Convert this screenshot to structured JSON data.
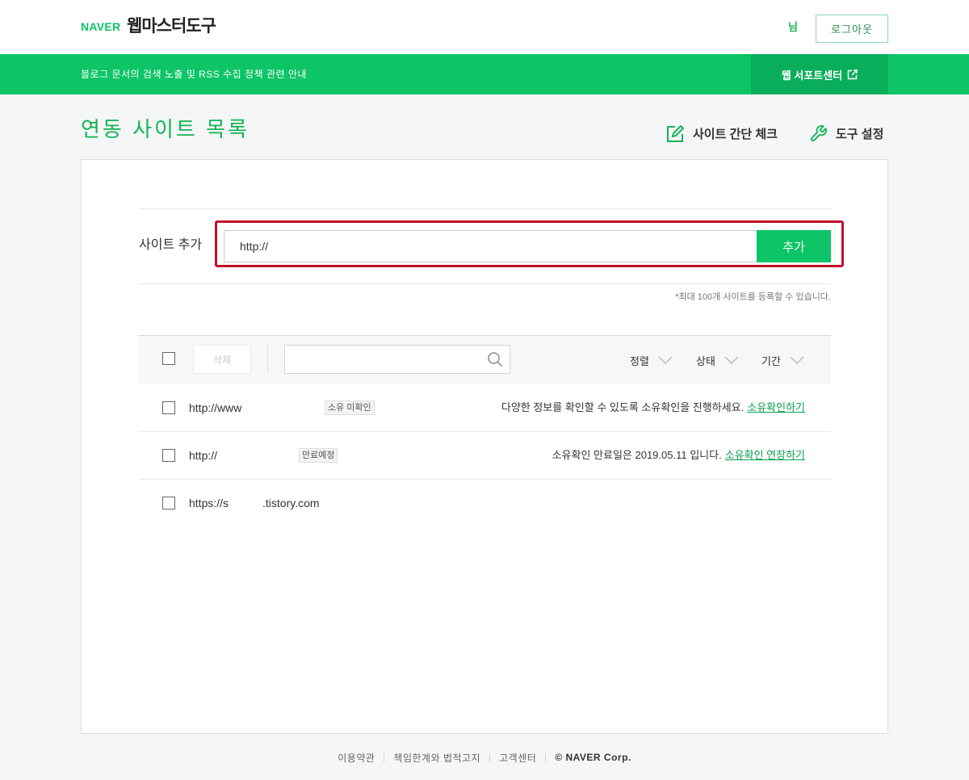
{
  "header": {
    "logo_naver": "NAVER",
    "logo_title": "웹마스터도구",
    "user_suffix": "님",
    "logout_label": "로그아웃"
  },
  "notice_bar": {
    "text": "블로그 문서의 검색 노출 및 RSS 수집 정책 관련 안내",
    "support_label": "웹 서포트센터",
    "support_icon": "external-link-icon"
  },
  "page": {
    "title": "연동 사이트 목록",
    "actions": [
      {
        "label": "사이트 간단 체크",
        "icon": "edit-box-icon"
      },
      {
        "label": "도구 설정",
        "icon": "wrench-icon"
      }
    ]
  },
  "add_site": {
    "label": "사이트 추가",
    "input_value": "http://",
    "button_label": "추가",
    "limit_note": "*최대 100개 사이트를 등록할 수 있습니다."
  },
  "toolbar": {
    "delete_label": "삭제",
    "search_value": "",
    "search_icon": "search-icon",
    "filters": [
      "정렬",
      "상태",
      "기간"
    ],
    "filter_icon": "chevron-down-icon"
  },
  "sites": [
    {
      "url": "http://www",
      "badge": "소유 미확인",
      "message": "다양한 정보를 확인할 수 있도록 소유확인을 진행하세요.",
      "link": "소유확인하기"
    },
    {
      "url": "http://",
      "badge": "만료예정",
      "message": "소유확인 만료일은 2019.05.11 입니다.",
      "link": "소유확인 연장하기"
    },
    {
      "url": "https://s",
      "url_suffix": ".tistory.com"
    }
  ],
  "footer": {
    "links": [
      "이용약관",
      "책임한계와 법적고지",
      "고객센터"
    ],
    "copyright": "© NAVER Corp."
  },
  "colors": {
    "brand_green": "#0dc466",
    "brand_green_dark": "#0aad59",
    "title_green": "#13b556",
    "link_green": "#0a9e4f",
    "highlight_red": "#c0102a"
  }
}
